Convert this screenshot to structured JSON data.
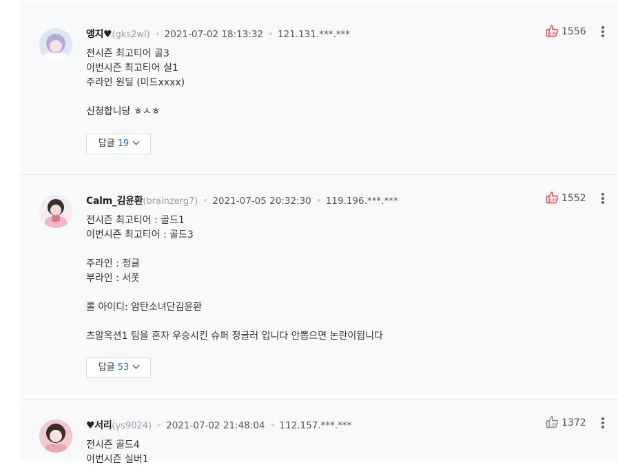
{
  "comments": [
    {
      "nickname": "앵지♥",
      "user_id": "(gks2wl)",
      "date": "2021-07-02 18:13:32",
      "ip": "121.131.***.***",
      "text": "전시즌 최고티어 골3\n이번시즌 최고티어 실1\n주라인 원딜 (미드xxxx)\n\n신청합니당 ㅎㅅㅎ",
      "reply_label": "답글",
      "reply_count": "19",
      "likes": "1556",
      "like_color": "#e8454f"
    },
    {
      "nickname": "Calm_김윤환",
      "user_id": "(brainzerg7)",
      "date": "2021-07-05 20:32:30",
      "ip": "119.196.***.***",
      "text": "전시즌 최고티어 : 골드1\n이번시즌 최고티어 : 골드3\n\n주라인 : 정글\n부라인 : 서폿\n\n롤 아이디: 암탄소녀단김윤환\n\n츠알옥션1 팀을 혼자 우승시킨 슈퍼 정글러 입니다 안뽑으면 논란이됩니다",
      "reply_label": "답글",
      "reply_count": "53",
      "likes": "1552",
      "like_color": "#e8454f"
    },
    {
      "nickname": "♥서리",
      "user_id": "(ys9024)",
      "date": "2021-07-02 21:48:04",
      "ip": "112.157.***.***",
      "text": "전시즌 골드4\n이번시즌 실버1",
      "likes": "1372",
      "like_color": "#777777"
    }
  ]
}
